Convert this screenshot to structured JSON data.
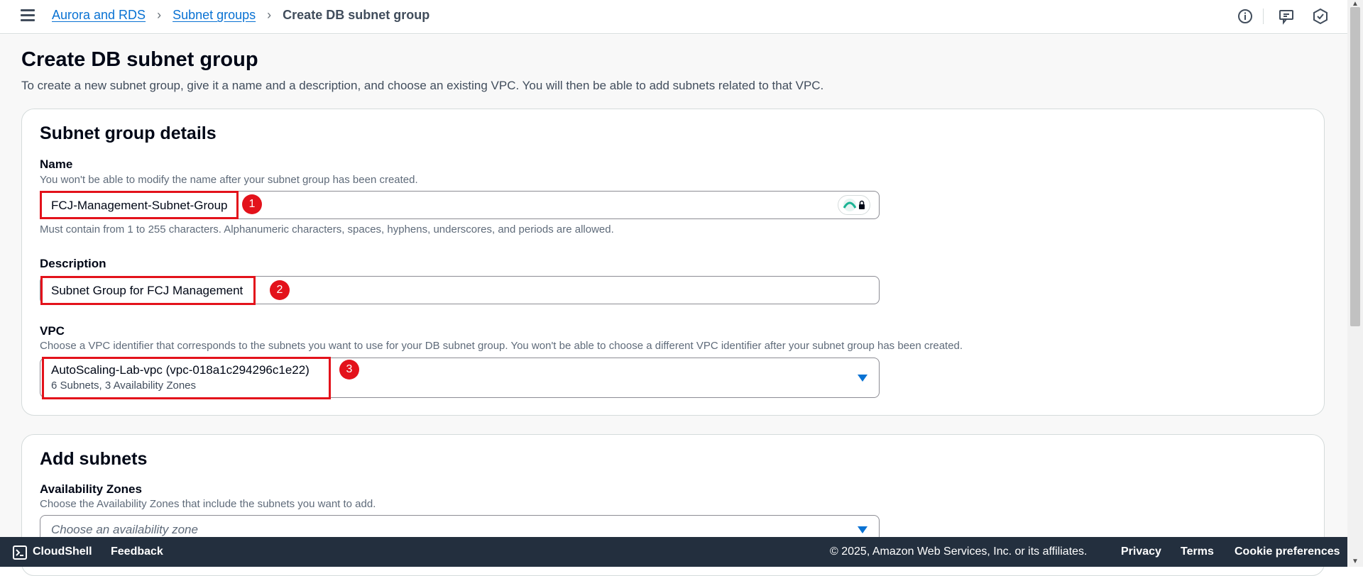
{
  "header": {
    "breadcrumbs": [
      "Aurora and RDS",
      "Subnet groups",
      "Create DB subnet group"
    ],
    "icons": [
      "info-icon",
      "feedback-icon",
      "settings-icon"
    ]
  },
  "page": {
    "title": "Create DB subnet group",
    "description": "To create a new subnet group, give it a name and a description, and choose an existing VPC. You will then be able to add subnets related to that VPC."
  },
  "details": {
    "title": "Subnet group details",
    "name": {
      "label": "Name",
      "hint": "You won't be able to modify the name after your subnet group has been created.",
      "value": "FCJ-Management-Subnet-Group",
      "constraint": "Must contain from 1 to 255 characters. Alphanumeric characters, spaces, hyphens, underscores, and periods are allowed.",
      "step": "1"
    },
    "description": {
      "label": "Description",
      "value": "Subnet Group for FCJ Management",
      "step": "2"
    },
    "vpc": {
      "label": "VPC",
      "hint": "Choose a VPC identifier that corresponds to the subnets you want to use for your DB subnet group. You won't be able to choose a different VPC identifier after your subnet group has been created.",
      "value": "AutoScaling-Lab-vpc (vpc-018a1c294296c1e22)",
      "sub_value": "6 Subnets, 3 Availability Zones",
      "step": "3"
    }
  },
  "subnets": {
    "title": "Add subnets",
    "az": {
      "label": "Availability Zones",
      "hint": "Choose the Availability Zones that include the subnets you want to add.",
      "placeholder": "Choose an availability zone"
    }
  },
  "footer": {
    "cloudshell": "CloudShell",
    "feedback": "Feedback",
    "copyright": "© 2025, Amazon Web Services, Inc. or its affiliates.",
    "privacy": "Privacy",
    "terms": "Terms",
    "cookies": "Cookie preferences"
  },
  "colors": {
    "link": "#0972d3",
    "highlight": "#e3121b",
    "footer_bg": "#232f3e"
  }
}
